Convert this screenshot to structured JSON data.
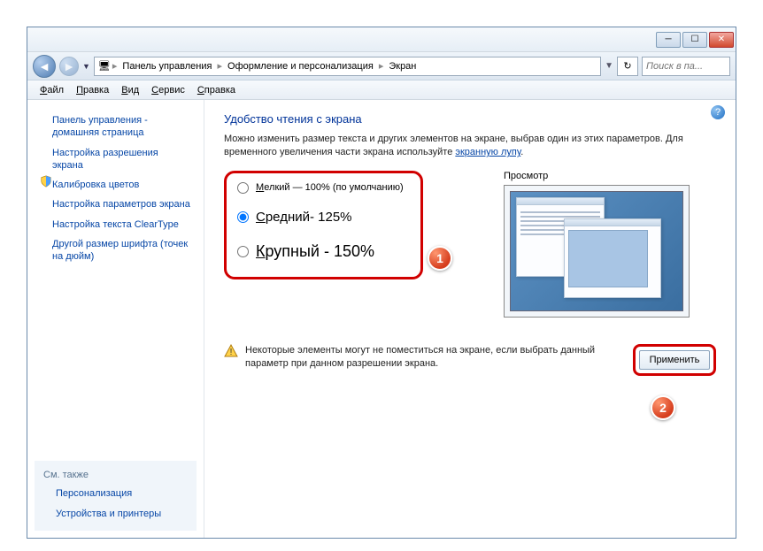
{
  "breadcrumb": {
    "root": "Панель управления",
    "mid": "Оформление и персонализация",
    "leaf": "Экран"
  },
  "search": {
    "placeholder": "Поиск в па..."
  },
  "menu": {
    "file": "Файл",
    "edit": "Правка",
    "view": "Вид",
    "tools": "Сервис",
    "help": "Справка"
  },
  "sidebar": {
    "home": "Панель управления - домашняя страница",
    "resolution": "Настройка разрешения экрана",
    "calibration": "Калибровка цветов",
    "params": "Настройка параметров экрана",
    "cleartype": "Настройка текста ClearType",
    "dpi": "Другой размер шрифта (точек на дюйм)",
    "see_also": "См. также",
    "personalization": "Персонализация",
    "devices": "Устройства и принтеры"
  },
  "main": {
    "title": "Удобство чтения с экрана",
    "desc1": "Можно изменить размер текста и других элементов на экране, выбрав один из этих параметров. Для временного увеличения части экрана используйте ",
    "magnifier": "экранную лупу",
    "dot": ".",
    "opt_small_pre": "М",
    "opt_small": "елкий — 100% (по умолчанию)",
    "opt_med_pre": "С",
    "opt_med": "редний- 125%",
    "opt_large_pre": "К",
    "opt_large": "рупный - 150%",
    "preview_label": "Просмотр",
    "warn": "Некоторые элементы могут не поместиться на экране, если выбрать данный параметр при данном разрешении экрана.",
    "apply": "Применить"
  },
  "badges": {
    "one": "1",
    "two": "2"
  }
}
